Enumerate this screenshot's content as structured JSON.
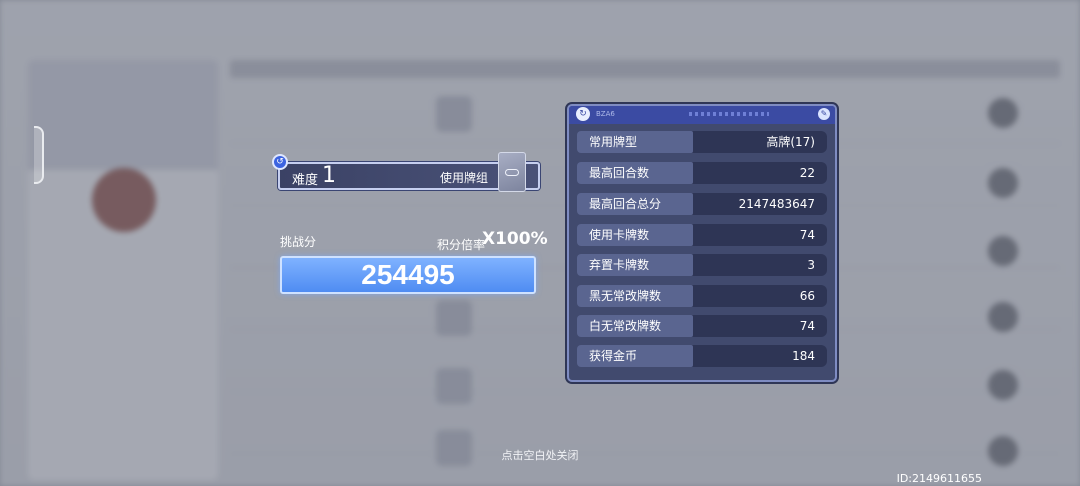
{
  "difficulty": {
    "label": "难度",
    "value": "1",
    "deck_label": "使用牌组"
  },
  "score": {
    "label": "挑战分",
    "multiplier_label": "积分倍率",
    "multiplier_value": "X100%",
    "value": "254495"
  },
  "stats": [
    {
      "label": "常用牌型",
      "value": "高牌(17)"
    },
    {
      "label": "最高回合数",
      "value": "22"
    },
    {
      "label": "最高回合总分",
      "value": "2147483647"
    },
    {
      "label": "使用卡牌数",
      "value": "74"
    },
    {
      "label": "弃置卡牌数",
      "value": "3"
    },
    {
      "label": "黑无常改牌数",
      "value": "66"
    },
    {
      "label": "白无常改牌数",
      "value": "74"
    },
    {
      "label": "获得金币",
      "value": "184"
    }
  ],
  "footer": {
    "close_hint": "点击空白处关闭",
    "uid": "ID:2149611655"
  },
  "colors": {
    "panel_bg": "#414a6e",
    "score_blue": "#4f8cf2",
    "accent": "#3b4ba3"
  }
}
